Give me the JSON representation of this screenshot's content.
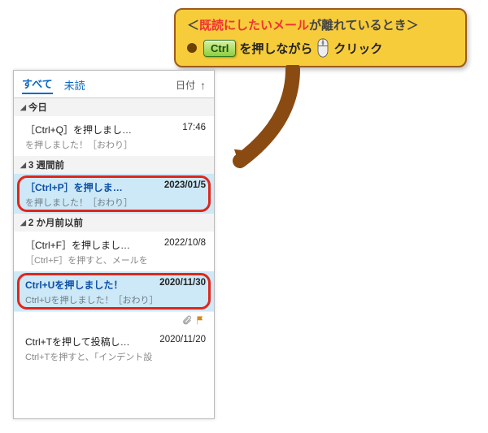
{
  "callout": {
    "line1_prefix": "＜",
    "line1_red": "既読にしたいメール",
    "line1_black": "が離れているとき＞",
    "ctrl_key": "Ctrl",
    "text_between": "を押しながら",
    "click_text": "クリック"
  },
  "tabs": {
    "all": "すべて",
    "unread": "未読",
    "sort_label": "日付"
  },
  "groups": {
    "today": "今日",
    "three_weeks": "3 週間前",
    "two_months": "2 か月前以前"
  },
  "items": {
    "a": {
      "subject": "［Ctrl+Q］を押しました！",
      "date": "17:46",
      "preview": "を押しました！［おわり］"
    },
    "b": {
      "subject": "［Ctrl+P］を押しました！",
      "date": "2023/01/5",
      "preview": "を押しました！［おわり］"
    },
    "c": {
      "subject": "［Ctrl+F］を押しました！",
      "date": "2022/10/8",
      "preview": "［Ctrl+F］を押すと、メールを"
    },
    "d": {
      "subject": "Ctrl+Uを押しました！",
      "date": "2020/11/30",
      "preview": "Ctrl+Uを押しました！［おわり］"
    },
    "e": {
      "subject": "Ctrl+Tを押して投稿します！",
      "date": "2020/11/20",
      "preview": "Ctrl+Tを押すと、「インデント設"
    }
  }
}
